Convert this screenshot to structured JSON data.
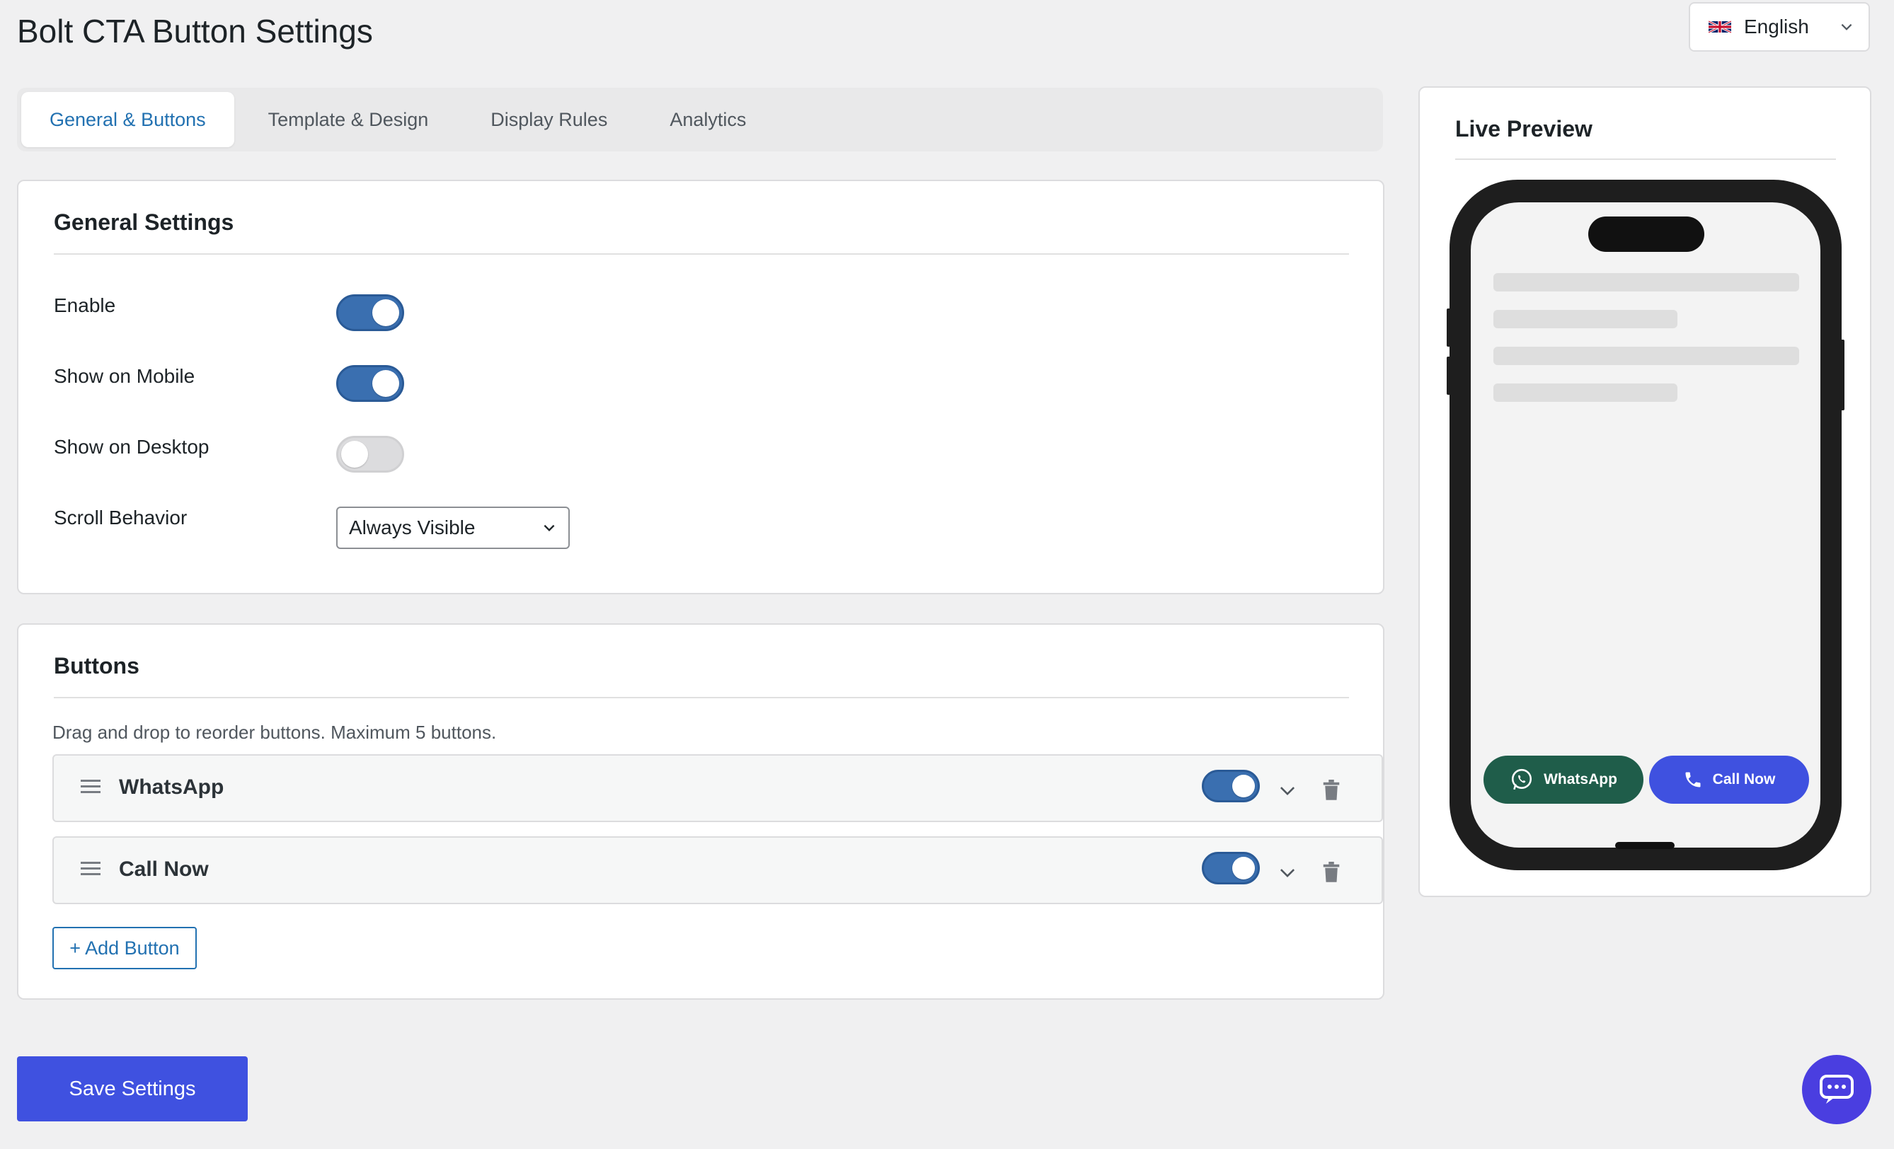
{
  "page": {
    "title": "Bolt CTA Button Settings"
  },
  "language": {
    "label": "English",
    "flag_icon": "uk-flag-icon"
  },
  "tabs": [
    {
      "label": "General & Buttons",
      "active": true
    },
    {
      "label": "Template & Design",
      "active": false
    },
    {
      "label": "Display Rules",
      "active": false
    },
    {
      "label": "Analytics",
      "active": false
    }
  ],
  "general": {
    "title": "General Settings",
    "enable": {
      "label": "Enable",
      "on": true
    },
    "show_mobile": {
      "label": "Show on Mobile",
      "on": true
    },
    "show_desktop": {
      "label": "Show on Desktop",
      "on": false
    },
    "scroll_behavior": {
      "label": "Scroll Behavior",
      "value": "Always Visible"
    }
  },
  "buttons": {
    "title": "Buttons",
    "hint": "Drag and drop to reorder buttons. Maximum 5 buttons.",
    "items": [
      {
        "label": "WhatsApp",
        "enabled": true
      },
      {
        "label": "Call Now",
        "enabled": true
      }
    ],
    "add_label": "+ Add Button"
  },
  "save_label": "Save Settings",
  "preview": {
    "title": "Live Preview",
    "cta": [
      {
        "label": "WhatsApp",
        "color": "#1f5d4a",
        "icon": "whatsapp-icon"
      },
      {
        "label": "Call Now",
        "color": "#3f51e0",
        "icon": "phone-icon"
      }
    ]
  },
  "colors": {
    "accent": "#2271b1",
    "toggle_on": "#3a6fb0",
    "primary_button": "#3f51e0",
    "chat_bubble": "#4a3ee0"
  }
}
